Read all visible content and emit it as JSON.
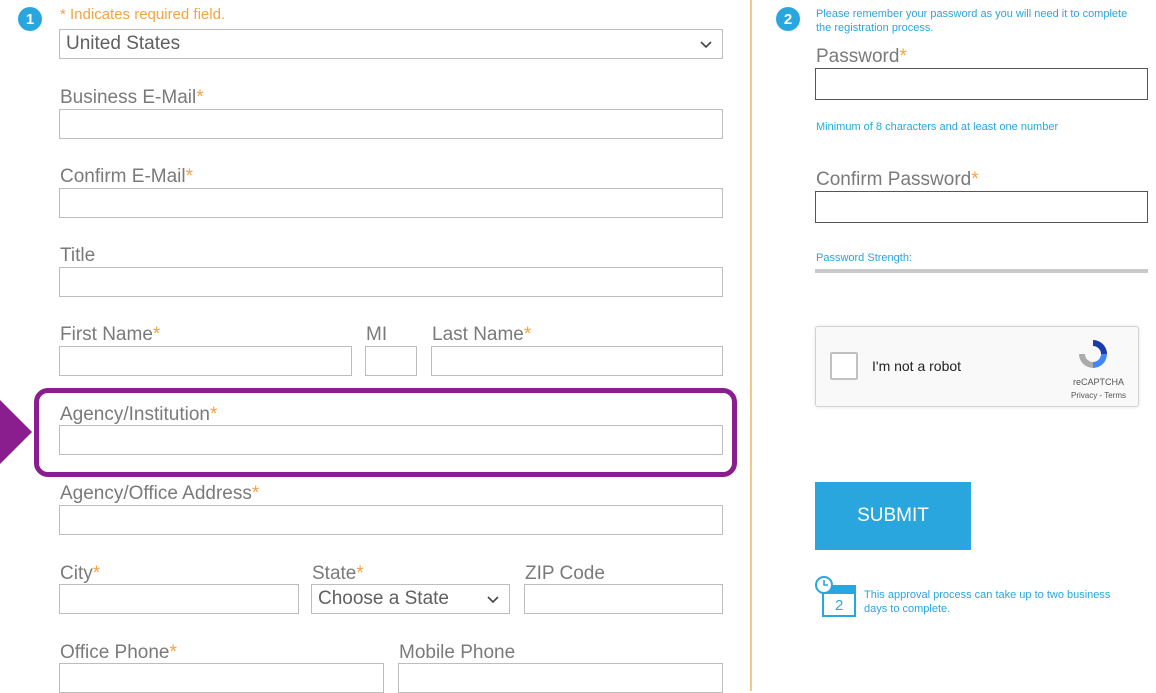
{
  "step1": {
    "number": "1",
    "required_note": "* Indicates required field."
  },
  "step2": {
    "number": "2",
    "note": "Please remember your password as you will need it to complete the registration process."
  },
  "country_select": {
    "value": "United States"
  },
  "fields": {
    "business_email": {
      "label": "Business E-Mail",
      "required": "*"
    },
    "confirm_email": {
      "label": "Confirm E-Mail",
      "required": "*"
    },
    "title": {
      "label": "Title"
    },
    "first_name": {
      "label": "First Name",
      "required": "*"
    },
    "mi": {
      "label": "MI"
    },
    "last_name": {
      "label": "Last Name",
      "required": "*"
    },
    "agency": {
      "label": "Agency/Institution",
      "required": "*"
    },
    "address": {
      "label": "Agency/Office Address",
      "required": "*"
    },
    "city": {
      "label": "City",
      "required": "*"
    },
    "state": {
      "label": "State",
      "required": "*",
      "placeholder": "Choose a State"
    },
    "zip": {
      "label": "ZIP Code"
    },
    "office_phone": {
      "label": "Office Phone",
      "required": "*"
    },
    "mobile_phone": {
      "label": "Mobile Phone"
    }
  },
  "password": {
    "label": "Password",
    "required": "*",
    "hint": "Minimum of 8 characters and at least one number",
    "confirm_label": "Confirm Password",
    "confirm_required": "*",
    "strength_label": "Password Strength:"
  },
  "recaptcha": {
    "label": "I'm not a robot",
    "brand": "reCAPTCHA",
    "links": "Privacy - Terms"
  },
  "submit": {
    "label": "SUBMIT"
  },
  "approval": {
    "day_count": "2",
    "note": "This approval process can take up to two business days to complete."
  },
  "colors": {
    "accent": "#29a6dd",
    "required": "#f5a440",
    "highlight": "#8b1e8e",
    "divider": "#f2c88a"
  }
}
